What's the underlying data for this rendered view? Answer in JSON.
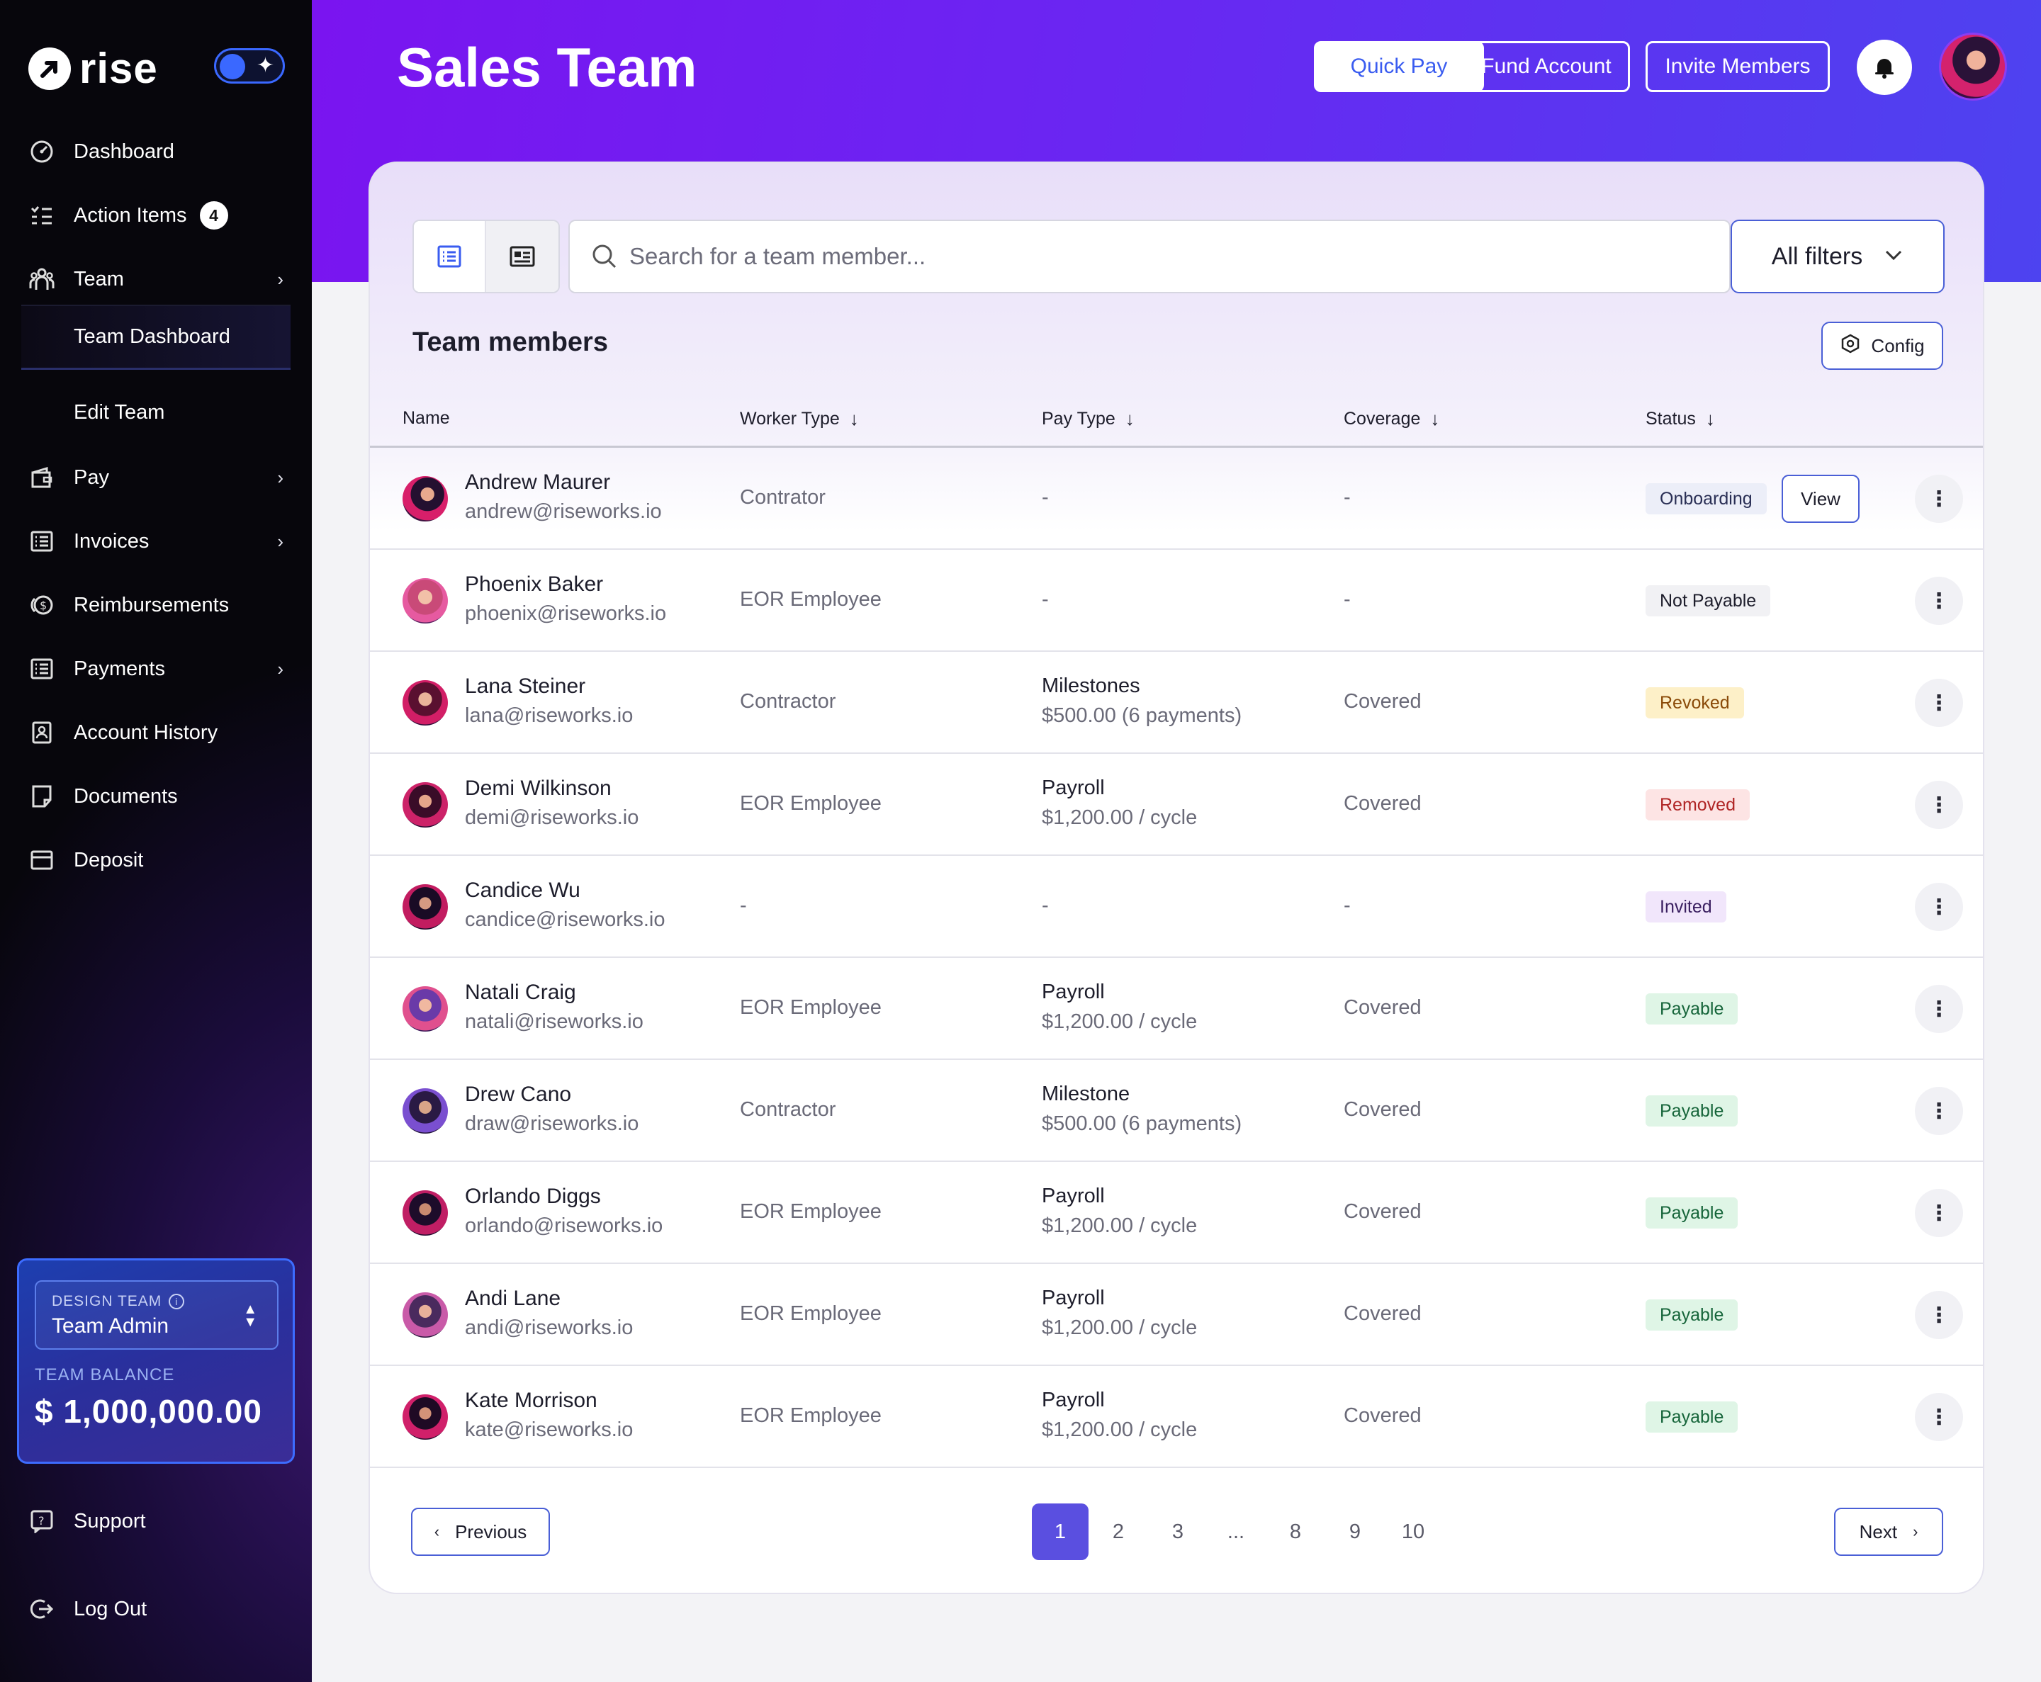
{
  "sidebar": {
    "brand": "rise",
    "nav": [
      {
        "label": "Dashboard",
        "icon": "dashboard-gauge-icon"
      },
      {
        "label": "Action Items",
        "icon": "checklist-icon",
        "badge": "4"
      },
      {
        "label": "Team",
        "icon": "team-people-icon",
        "chevron": true
      },
      {
        "label": "Team Dashboard",
        "sub": true,
        "active": true
      },
      {
        "label": "Edit Team",
        "sub": true
      },
      {
        "label": "Pay",
        "icon": "wallet-icon",
        "chevron": true
      },
      {
        "label": "Invoices",
        "icon": "invoice-list-icon",
        "chevron": true
      },
      {
        "label": "Reimbursements",
        "icon": "coins-icon"
      },
      {
        "label": "Payments",
        "icon": "payments-list-icon",
        "chevron": true
      },
      {
        "label": "Account History",
        "icon": "account-history-icon"
      },
      {
        "label": "Documents",
        "icon": "document-icon"
      },
      {
        "label": "Deposit",
        "icon": "deposit-card-icon"
      }
    ],
    "team_card": {
      "team_caption": "DESIGN TEAM",
      "role": "Team Admin",
      "balance_label": "TEAM BALANCE",
      "balance": "$ 1,000,000.00"
    },
    "support": "Support",
    "logout": "Log Out"
  },
  "header": {
    "title": "Sales Team",
    "buttons": {
      "quick_pay": "Quick Pay",
      "fund_account": "Fund Account",
      "invite_members": "Invite Members"
    }
  },
  "toolbar": {
    "search_placeholder": "Search for a team member...",
    "filters_label": "All filters"
  },
  "section": {
    "title": "Team members",
    "config_label": "Config"
  },
  "table": {
    "columns": [
      "Name",
      "Worker Type",
      "Pay Type",
      "Coverage",
      "Status"
    ],
    "rows": [
      {
        "name": "Andrew Maurer",
        "email": "andrew@riseworks.io",
        "worker_type": "Contrator",
        "pay_type": "-",
        "pay_detail": "",
        "coverage": "-",
        "status": "Onboarding",
        "action": "View"
      },
      {
        "name": "Phoenix Baker",
        "email": "phoenix@riseworks.io",
        "worker_type": "EOR Employee",
        "pay_type": "-",
        "pay_detail": "",
        "coverage": "-",
        "status": "Not Payable"
      },
      {
        "name": "Lana Steiner",
        "email": "lana@riseworks.io",
        "worker_type": "Contractor",
        "pay_type": "Milestones",
        "pay_detail": "$500.00 (6 payments)",
        "coverage": "Covered",
        "status": "Revoked"
      },
      {
        "name": "Demi Wilkinson",
        "email": "demi@riseworks.io",
        "worker_type": "EOR Employee",
        "pay_type": "Payroll",
        "pay_detail": "$1,200.00 / cycle",
        "coverage": "Covered",
        "status": "Removed"
      },
      {
        "name": "Candice Wu",
        "email": "candice@riseworks.io",
        "worker_type": "-",
        "pay_type": "-",
        "pay_detail": "",
        "coverage": "-",
        "status": "Invited"
      },
      {
        "name": "Natali Craig",
        "email": "natali@riseworks.io",
        "worker_type": "EOR Employee",
        "pay_type": "Payroll",
        "pay_detail": "$1,200.00 / cycle",
        "coverage": "Covered",
        "status": "Payable"
      },
      {
        "name": "Drew Cano",
        "email": "draw@riseworks.io",
        "worker_type": "Contractor",
        "pay_type": "Milestone",
        "pay_detail": "$500.00 (6 payments)",
        "coverage": "Covered",
        "status": "Payable"
      },
      {
        "name": "Orlando Diggs",
        "email": "orlando@riseworks.io",
        "worker_type": "EOR Employee",
        "pay_type": "Payroll",
        "pay_detail": "$1,200.00 / cycle",
        "coverage": "Covered",
        "status": "Payable"
      },
      {
        "name": "Andi Lane",
        "email": "andi@riseworks.io",
        "worker_type": "EOR Employee",
        "pay_type": "Payroll",
        "pay_detail": "$1,200.00 / cycle",
        "coverage": "Covered",
        "status": "Payable"
      },
      {
        "name": "Kate Morrison",
        "email": "kate@riseworks.io",
        "worker_type": "EOR Employee",
        "pay_type": "Payroll",
        "pay_detail": "$1,200.00 / cycle",
        "coverage": "Covered",
        "status": "Payable"
      }
    ]
  },
  "status_colors": {
    "Onboarding": {
      "bg": "#eceef8",
      "fg": "#2a2f55"
    },
    "Not Payable": {
      "bg": "#f1f1f4",
      "fg": "#1d1d2b"
    },
    "Revoked": {
      "bg": "#fdf0c8",
      "fg": "#8a4a08"
    },
    "Removed": {
      "bg": "#fde4e4",
      "fg": "#b02525"
    },
    "Invited": {
      "bg": "#f1e6fb",
      "fg": "#3a1f60"
    },
    "Payable": {
      "bg": "#dff5e6",
      "fg": "#16653a"
    }
  },
  "pagination": {
    "previous": "Previous",
    "next": "Next",
    "pages": [
      "1",
      "2",
      "3",
      "...",
      "8",
      "9",
      "10"
    ],
    "current": "1"
  },
  "colors": {
    "accent": "#5a4fe0",
    "header_start": "#7a14f0",
    "header_end": "#4d43f0",
    "link_blue": "#3a5cf0"
  }
}
